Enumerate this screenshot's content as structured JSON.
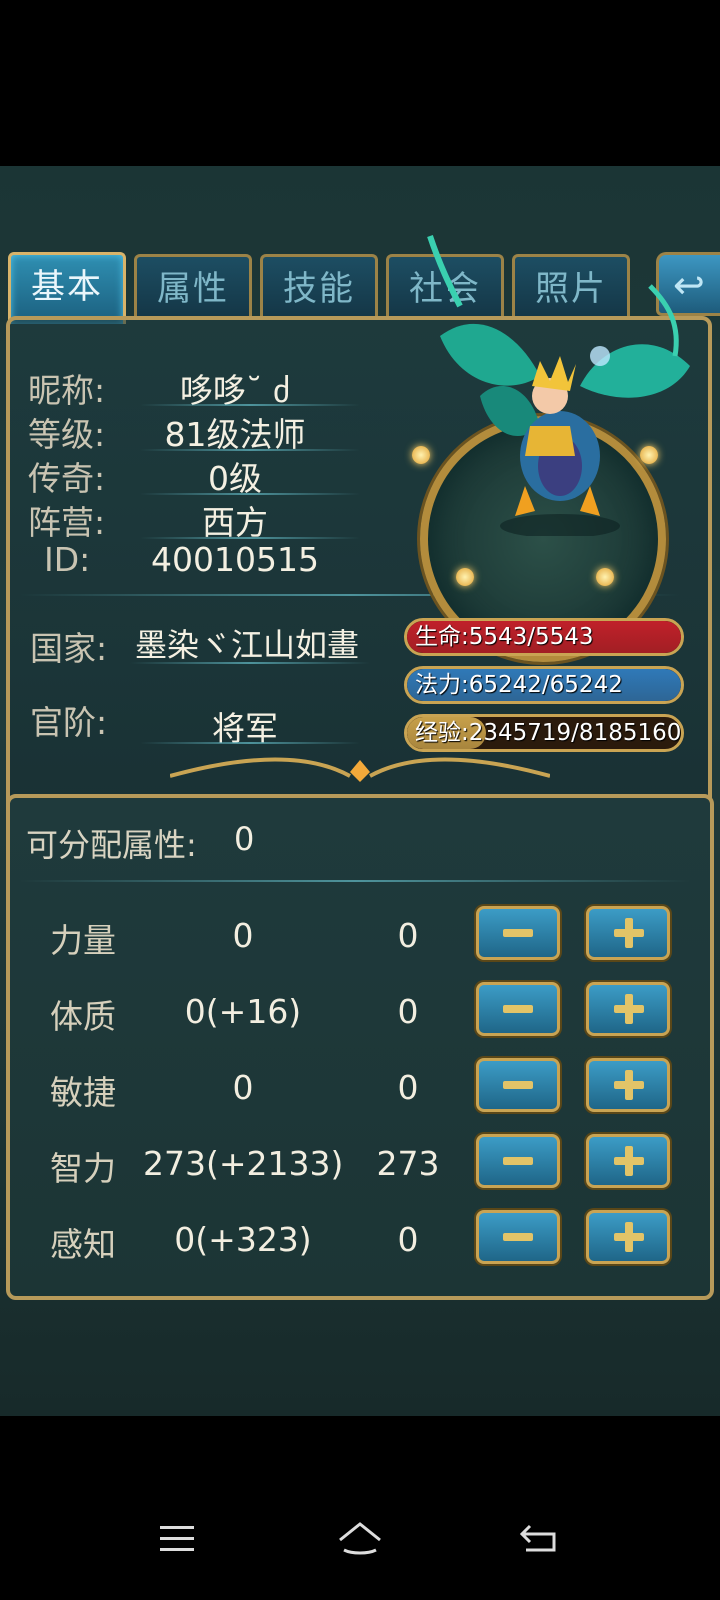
{
  "tabs": {
    "basic": "基本",
    "attributes": "属性",
    "skills": "技能",
    "social": "社会",
    "photos": "照片"
  },
  "profile": {
    "nickname_label": "昵称:",
    "nickname": "哆哆˘ ძ",
    "level_label": "等级:",
    "level": "81级法师",
    "legend_label": "传奇:",
    "legend": "0级",
    "camp_label": "阵营:",
    "camp": "西方",
    "id_label": "ID:",
    "id": "40010515",
    "country_label": "国家:",
    "country": "墨染ヾ江山如畫",
    "rank_label": "官阶:",
    "rank": "将军"
  },
  "bars": {
    "hp_text": "生命:5543/5543",
    "hp_fraction": 1.0,
    "hp_color": "#c0202a",
    "mp_text": "法力:65242/65242",
    "mp_fraction": 1.0,
    "mp_color": "#2f79b8",
    "exp_text": "经验:2345719/8185160",
    "exp_fraction": 0.287,
    "exp_color": "#c7a04a"
  },
  "allocation": {
    "label": "可分配属性:",
    "points": "0"
  },
  "attributes": [
    {
      "name": "力量",
      "value": "0",
      "alloc": "0"
    },
    {
      "name": "体质",
      "value": "0(+16)",
      "alloc": "0"
    },
    {
      "name": "敏捷",
      "value": "0",
      "alloc": "0"
    },
    {
      "name": "智力",
      "value": "273(+2133)",
      "alloc": "273"
    },
    {
      "name": "感知",
      "value": "0(+323)",
      "alloc": "0"
    }
  ],
  "navbar": {
    "menu_icon": "menu-icon",
    "home_icon": "home-icon",
    "back_icon": "back-icon"
  }
}
